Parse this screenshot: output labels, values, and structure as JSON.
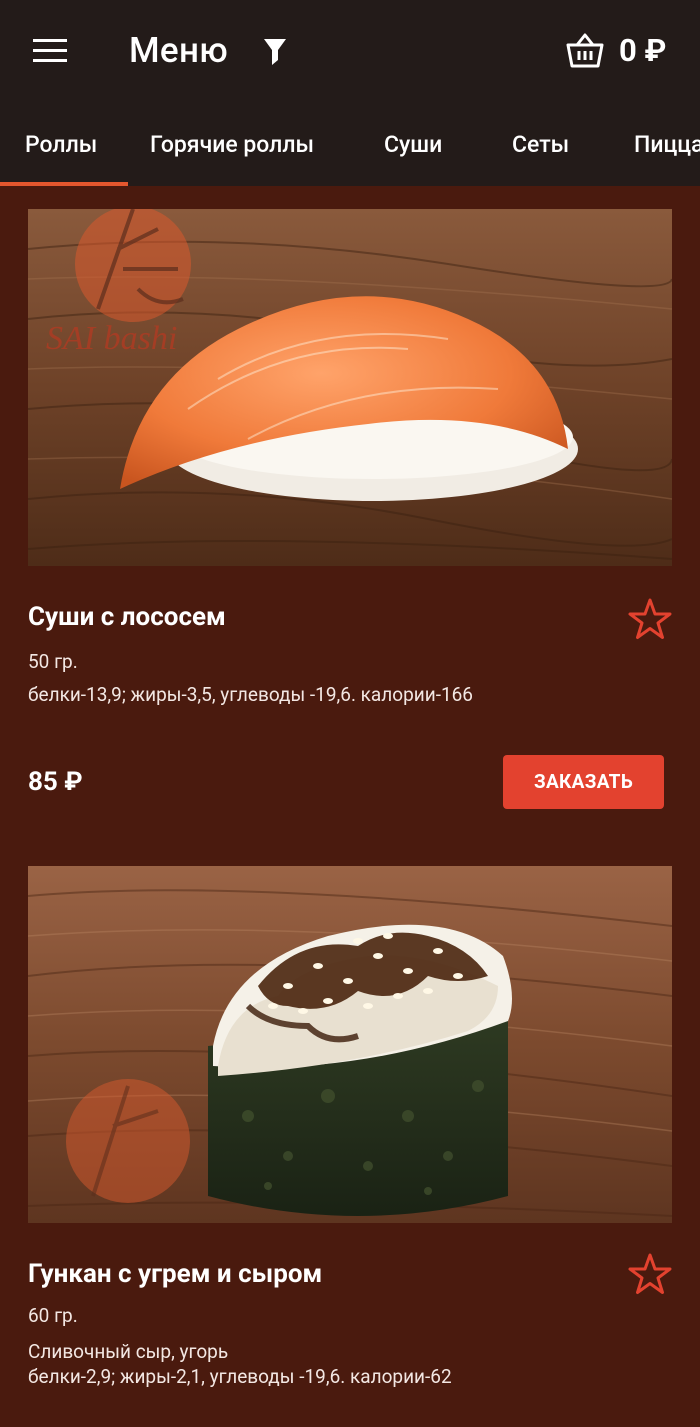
{
  "header": {
    "title": "Меню",
    "cart_total": "0 ₽"
  },
  "tabs": [
    {
      "label": "Роллы",
      "active": true
    },
    {
      "label": "Горячие роллы",
      "active": false
    },
    {
      "label": "Суши",
      "active": false
    },
    {
      "label": "Сеты",
      "active": false
    },
    {
      "label": "Пицца",
      "active": false
    }
  ],
  "products": [
    {
      "name": "Суши с лососем",
      "weight": "50 гр.",
      "description": "",
      "nutrition": "белки-13,9; жиры-3,5, углеводы -19,6. калории-166",
      "price": "85 ₽",
      "order_label": "ЗАКАЗАТЬ",
      "watermark": "SAI bashi"
    },
    {
      "name": "Гункан с угрем и сыром",
      "weight": "60 гр.",
      "description": "Сливочный сыр, угорь",
      "nutrition": "белки-2,9; жиры-2,1, углеводы -19,6. калории-62"
    }
  ],
  "colors": {
    "background": "#4a1a0e",
    "bar": "#231b19",
    "accent": "#e3422f",
    "tab_indicator": "#e4572e"
  }
}
